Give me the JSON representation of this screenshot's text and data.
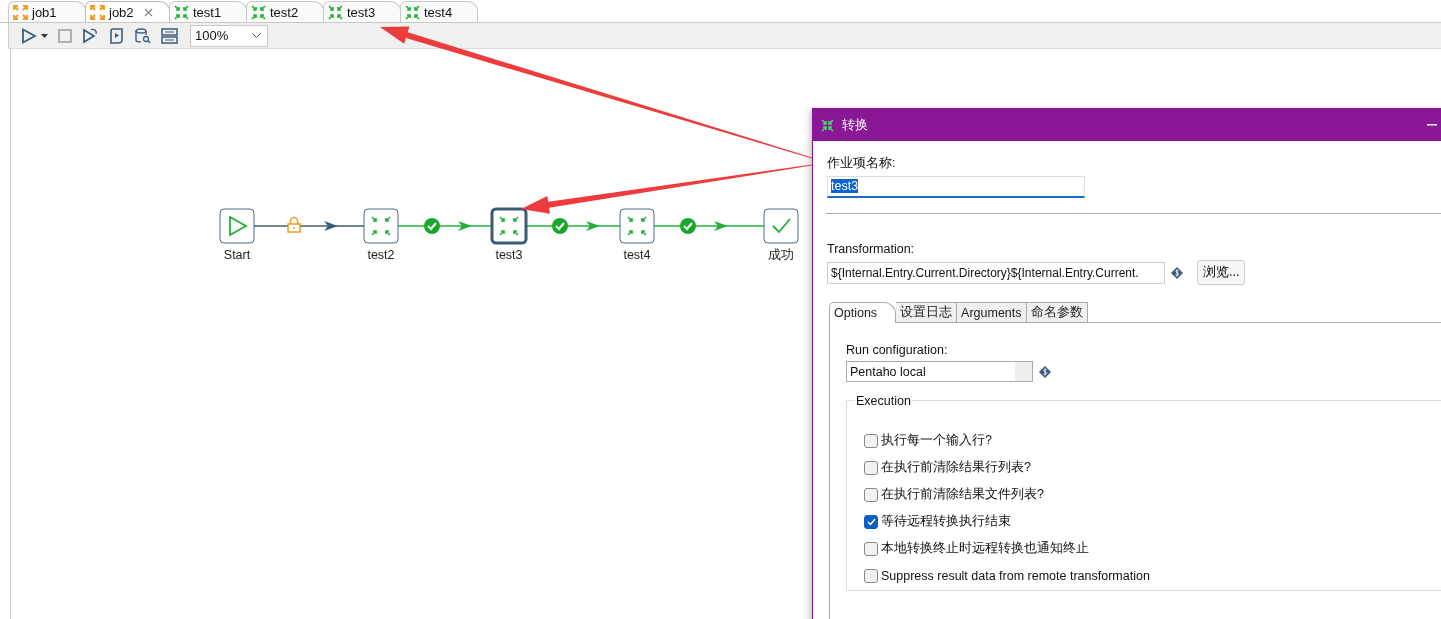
{
  "tabs": [
    {
      "label": "job1",
      "kind": "job",
      "selected": false,
      "closable": false
    },
    {
      "label": "job2",
      "kind": "job",
      "selected": true,
      "closable": true
    },
    {
      "label": "test1",
      "kind": "trans",
      "selected": false,
      "closable": false
    },
    {
      "label": "test2",
      "kind": "trans",
      "selected": false,
      "closable": false
    },
    {
      "label": "test3",
      "kind": "trans",
      "selected": false,
      "closable": false
    },
    {
      "label": "test4",
      "kind": "trans",
      "selected": false,
      "closable": false
    }
  ],
  "toolbar": {
    "zoom": "100%"
  },
  "job_canvas": {
    "nodes": [
      {
        "label": "Start",
        "kind": "start",
        "selected": false
      },
      {
        "label": "test2",
        "kind": "trans",
        "selected": false
      },
      {
        "label": "test3",
        "kind": "trans",
        "selected": true
      },
      {
        "label": "test4",
        "kind": "trans",
        "selected": false
      },
      {
        "label": "成功",
        "kind": "success",
        "selected": false
      }
    ],
    "hops": [
      {
        "kind": "unconditional"
      },
      {
        "kind": "success"
      },
      {
        "kind": "success"
      },
      {
        "kind": "success"
      }
    ]
  },
  "dialog": {
    "title": "转换",
    "name_label": "作业项名称:",
    "name_value": "test3",
    "transformation_label": "Transformation:",
    "transformation_value": "${Internal.Entry.Current.Directory}${Internal.Entry.Current.",
    "browse_button": "浏览...",
    "tabs": [
      {
        "label": "Options",
        "selected": true
      },
      {
        "label": "设置日志",
        "selected": false
      },
      {
        "label": "Arguments",
        "selected": false
      },
      {
        "label": "命名参数",
        "selected": false
      }
    ],
    "run_config_label": "Run configuration:",
    "run_config_value": "Pentaho local",
    "execution_group": "Execution",
    "options": [
      {
        "label": "执行每一个输入行?",
        "checked": false
      },
      {
        "label": "在执行前清除结果行列表?",
        "checked": false
      },
      {
        "label": "在执行前清除结果文件列表?",
        "checked": false
      },
      {
        "label": "等待远程转换执行结束",
        "checked": true
      },
      {
        "label": "本地转换终止时远程转换也通知终止",
        "checked": false
      },
      {
        "label": "Suppress result data from remote transformation",
        "checked": false
      }
    ]
  }
}
